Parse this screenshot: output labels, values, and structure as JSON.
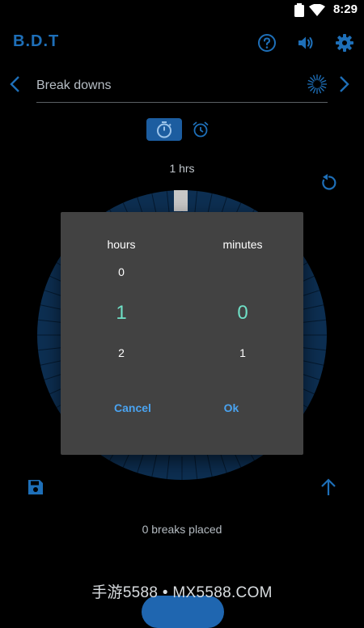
{
  "status_bar": {
    "time": "8:29"
  },
  "app_bar": {
    "title": "B.D.T"
  },
  "break": {
    "placeholder": "Break downs"
  },
  "duration_label": "1 hrs",
  "breaks_status": "0 breaks placed",
  "watermark": "手游5588 • MX5588.COM",
  "dialog": {
    "hours_label": "hours",
    "minutes_label": "minutes",
    "hours_prev": "0",
    "hours_selected": "1",
    "hours_next": "2",
    "minutes_selected": "0",
    "minutes_next": "1",
    "cancel_label": "Cancel",
    "ok_label": "Ok"
  },
  "colors": {
    "accent": "#1e6fb8",
    "selected_value": "#6fe0c6",
    "dialog_bg": "#424242",
    "dial": "#0d2f52"
  }
}
